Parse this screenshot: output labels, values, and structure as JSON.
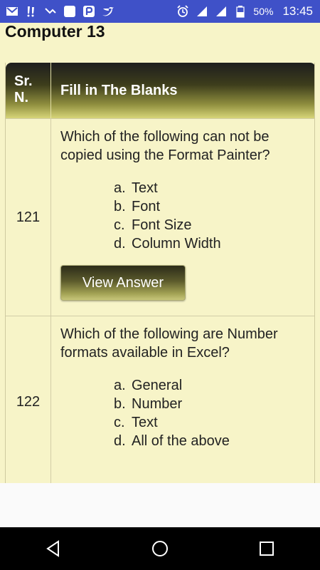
{
  "status_bar": {
    "battery_percent": "50%",
    "time": "13:45",
    "icons_left": [
      "gmail-icon",
      "notification-icon",
      "missed-call-icon",
      "app-icon",
      "p-app-icon",
      "twitter-icon"
    ],
    "icons_right": [
      "alarm-icon",
      "signal-icon",
      "signal-icon",
      "battery-icon"
    ]
  },
  "page": {
    "title": "Computer 13"
  },
  "table": {
    "header": {
      "sr_label": "Sr. N.",
      "title_label": "Fill in The Blanks"
    },
    "rows": [
      {
        "number": "121",
        "question": "Which of the following can not be copied using the Format Painter?",
        "options": [
          {
            "letter": "a.",
            "text": "Text"
          },
          {
            "letter": "b.",
            "text": "Font"
          },
          {
            "letter": "c.",
            "text": "Font Size"
          },
          {
            "letter": "d.",
            "text": "Column Width"
          }
        ],
        "button_label": "View Answer"
      },
      {
        "number": "122",
        "question": "Which of the following are Number formats available in Excel?",
        "options": [
          {
            "letter": "a.",
            "text": "General"
          },
          {
            "letter": "b.",
            "text": "Number"
          },
          {
            "letter": "c.",
            "text": "Text"
          },
          {
            "letter": "d.",
            "text": "All of the above"
          }
        ]
      }
    ]
  },
  "colors": {
    "status_bar": "#3f51c8",
    "page_background": "#f7f4c8",
    "nav_bar": "#000000"
  }
}
